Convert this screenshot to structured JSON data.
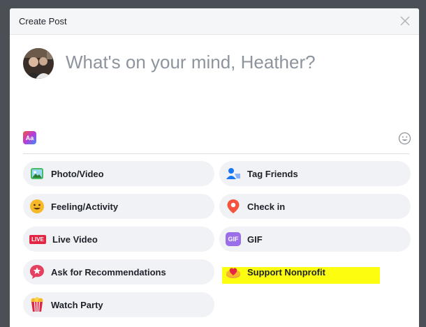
{
  "dialog": {
    "title": "Create Post",
    "close_icon": "close-icon"
  },
  "composer": {
    "placeholder": "What's on your mind, Heather?",
    "text_format_label": "Aa"
  },
  "options": [
    {
      "label": "Photo/Video",
      "icon": "photo-icon"
    },
    {
      "label": "Tag Friends",
      "icon": "tag-friends-icon"
    },
    {
      "label": "Feeling/Activity",
      "icon": "feeling-icon"
    },
    {
      "label": "Check in",
      "icon": "location-pin-icon"
    },
    {
      "label": "Live Video",
      "icon": "live-icon",
      "badge": "LIVE"
    },
    {
      "label": "GIF",
      "icon": "gif-icon",
      "badge": "GIF"
    },
    {
      "label": "Ask for Recommendations",
      "icon": "recommendations-icon"
    },
    {
      "label": "Support Nonprofit",
      "icon": "nonprofit-icon"
    },
    {
      "label": "Watch Party",
      "icon": "watch-party-icon"
    }
  ],
  "colors": {
    "highlight": "#fdfd10",
    "option_bg": "#f0f2f5",
    "placeholder": "#8d949e"
  }
}
